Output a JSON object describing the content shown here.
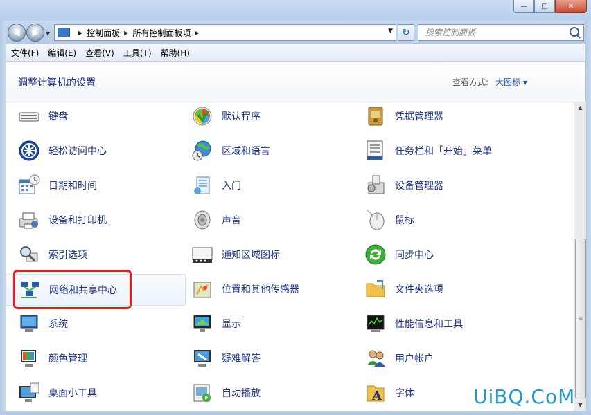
{
  "window": {
    "controls": {
      "min": "—",
      "max": "□",
      "close": "✕"
    }
  },
  "address": {
    "crumbs": [
      "控制面板",
      "所有控制面板项"
    ],
    "search_placeholder": "搜索控制面板"
  },
  "menu": [
    "文件(F)",
    "编辑(E)",
    "查看(V)",
    "工具(T)",
    "帮助(H)"
  ],
  "header": {
    "title": "调整计算机的设置",
    "viewby_label": "查看方式:",
    "viewby_value": "大图标 ▾"
  },
  "items": [
    {
      "label": "键盘",
      "icon": "keyboard-icon"
    },
    {
      "label": "默认程序",
      "icon": "default-programs-icon"
    },
    {
      "label": "凭据管理器",
      "icon": "credential-manager-icon"
    },
    {
      "label": "轻松访问中心",
      "icon": "ease-of-access-icon"
    },
    {
      "label": "区域和语言",
      "icon": "region-language-icon"
    },
    {
      "label": "任务栏和「开始」菜单",
      "icon": "taskbar-icon"
    },
    {
      "label": "日期和时间",
      "icon": "date-time-icon"
    },
    {
      "label": "入门",
      "icon": "getting-started-icon"
    },
    {
      "label": "设备管理器",
      "icon": "device-manager-icon"
    },
    {
      "label": "设备和打印机",
      "icon": "devices-printers-icon"
    },
    {
      "label": "声音",
      "icon": "sound-icon"
    },
    {
      "label": "鼠标",
      "icon": "mouse-icon"
    },
    {
      "label": "索引选项",
      "icon": "indexing-icon"
    },
    {
      "label": "通知区域图标",
      "icon": "notification-icon"
    },
    {
      "label": "同步中心",
      "icon": "sync-center-icon"
    },
    {
      "label": "网络和共享中心",
      "icon": "network-sharing-icon"
    },
    {
      "label": "位置和其他传感器",
      "icon": "location-sensors-icon"
    },
    {
      "label": "文件夹选项",
      "icon": "folder-options-icon"
    },
    {
      "label": "系统",
      "icon": "system-icon"
    },
    {
      "label": "显示",
      "icon": "display-icon"
    },
    {
      "label": "性能信息和工具",
      "icon": "performance-icon"
    },
    {
      "label": "颜色管理",
      "icon": "color-management-icon"
    },
    {
      "label": "疑难解答",
      "icon": "troubleshooting-icon"
    },
    {
      "label": "用户帐户",
      "icon": "user-accounts-icon"
    },
    {
      "label": "桌面小工具",
      "icon": "desktop-gadgets-icon"
    },
    {
      "label": "自动播放",
      "icon": "autoplay-icon"
    },
    {
      "label": "字体",
      "icon": "fonts-icon"
    }
  ],
  "watermark": "UiBQ.CoM",
  "colors": {
    "link": "#1e3287",
    "highlight": "#e3201b",
    "accent": "#1e52b5"
  }
}
